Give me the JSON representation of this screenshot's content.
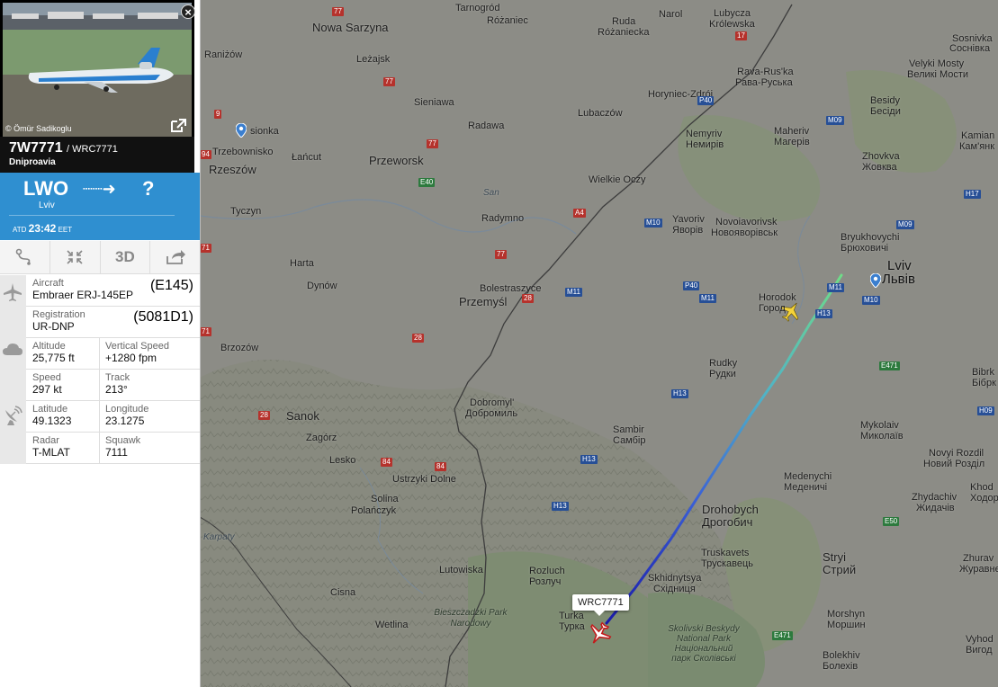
{
  "photo": {
    "credit": "© Ömür Sadikoglu"
  },
  "flight": {
    "number": "7W7771",
    "callsign": "/ WRC7771",
    "airline": "Dniproavia"
  },
  "route": {
    "from_code": "LWO",
    "from_city": "Lviv",
    "arrow": "⇢",
    "to_code": "?",
    "atd_label": "ATD",
    "atd_time": "23:42",
    "atd_tz": "EET"
  },
  "toolbar": {
    "route_icon": "route-icon",
    "fit_icon": "fit-icon",
    "three_d": "3D",
    "share_icon": "share-icon"
  },
  "details": {
    "aircraft_label": "Aircraft",
    "aircraft_value": "Embraer ERJ-145EP",
    "aircraft_code": "(E145)",
    "registration_label": "Registration",
    "registration_value": "UR-DNP",
    "registration_code": "(5081D1)",
    "altitude_label": "Altitude",
    "altitude_value": "25,775 ft",
    "vspeed_label": "Vertical Speed",
    "vspeed_value": "+1280 fpm",
    "speed_label": "Speed",
    "speed_value": "297 kt",
    "track_label": "Track",
    "track_value": "213°",
    "lat_label": "Latitude",
    "lat_value": "49.1323",
    "lon_label": "Longitude",
    "lon_value": "23.1275",
    "radar_label": "Radar",
    "radar_value": "T-MLAT",
    "squawk_label": "Squawk",
    "squawk_value": "7111"
  },
  "map": {
    "flight_tag": "WRC7771",
    "places": {
      "tarnogrod": "Tarnogród",
      "rozaniec": "Różaniec",
      "ruda": "Ruda",
      "ruda2": "Różaniecka",
      "narol": "Narol",
      "lubycza": "Lubycza",
      "lubycza2": "Królewska",
      "sosnivka": "Sosnivka",
      "sosnivka2": "Соснівка",
      "nowa": "Nowa Sarzyna",
      "lezajsk": "Leżajsk",
      "ranizow": "Raniżów",
      "ravarus": "Rava-Rus'ka",
      "ravarus2": "Рава-Руська",
      "velyki": "Velyki Mosty",
      "velyki2": "Великі Мости",
      "horyniec": "Horyniec-Zdrój",
      "sieniawa": "Sieniawa",
      "radawa": "Radawa",
      "lubaczow": "Lubaczów",
      "besidy": "Besidy",
      "besidy2": "Бесіди",
      "nemyriv": "Nemyriv",
      "nemyriv2": "Немирів",
      "maheriv": "Maheriv",
      "maheriv2": "Магерів",
      "kamianka": "Kamian",
      "kamianka2": "Кам'янк",
      "trzebownisko": "Trzebownisko",
      "lancut": "Łańcut",
      "przeworsk": "Przeworsk",
      "zhovkva": "Zhovkva",
      "zhovkva2": "Жовква",
      "rzeszow": "Rzeszów",
      "wielkie": "Wielkie Oczy",
      "tyczyn": "Tyczyn",
      "radymno": "Radymno",
      "yavoriv": "Yavoriv",
      "yavoriv2": "Яворів",
      "novoyav": "Novoiavorivsk",
      "novoyav2": "Новояворівськ",
      "bryuk": "Bryukhovychi",
      "bryuk2": "Брюховичі",
      "lviv": "Lviv",
      "lviv2": "Львів",
      "harta": "Harta",
      "bolestr": "Bolestraszyce",
      "dynow": "Dynów",
      "przemysl": "Przemyśl",
      "horodok": "Horodok",
      "horodok2": "Город",
      "brzozow": "Brzozów",
      "rudky": "Rudky",
      "rudky2": "Рудки",
      "bibrka": "Bibrk",
      "bibrka2": "Бібрк",
      "sanok": "Sanok",
      "dobromyl": "Dobromyl'",
      "dobromyl2": "Добромиль",
      "sambir": "Sambir",
      "sambir2": "Самбір",
      "mykolaiv": "Mykolaiv",
      "mykolaiv2": "Миколаїв",
      "zagorz": "Zagórz",
      "novyi": "Novyi Rozdil",
      "novyi2": "Новий Розділ",
      "lesko": "Lesko",
      "ustrzyki": "Ustrzyki Dolne",
      "medenychi": "Medenychi",
      "medenychi2": "Меденичі",
      "khod": "Khod",
      "khod2": "Ходор",
      "solina": "Solina",
      "polanczyk": "Polańczyk",
      "drohobych": "Drohobych",
      "drohobych2": "Дрогобич",
      "zhydachiv": "Zhydachiv",
      "zhydachiv2": "Жидачів",
      "karpaty": "Karpaty",
      "truskavets": "Truskavets",
      "truskavets2": "Трускавець",
      "lutowiska": "Lutowiska",
      "rozluch": "Rozluch",
      "rozluch2": "Розлуч",
      "skhidnytsya": "Skhidnytsya",
      "skhidnytsya2": "Східниця",
      "stryi": "Stryi",
      "stryi2": "Стрий",
      "zhuravne": "Zhurav",
      "zhuravne2": "Журавне",
      "cisna": "Cisna",
      "turka": "Turka",
      "turka2": "Турка",
      "morshyn": "Morshyn",
      "morshyn2": "Моршин",
      "wetlina": "Wetlina",
      "bieszczady": "Bieszczadzki Park Narodowy",
      "skolivski": "Skolivski Beskydy National Park Національний парк Сколівські",
      "bolekhiv": "Bolekhiv",
      "bolekhiv2": "Болехів",
      "vyhod": "Vyhod",
      "vyhod2": "Вигод",
      "san": "San",
      "pionka": "sionka"
    },
    "roads": {
      "r77a": "77",
      "r77b": "77",
      "r77c": "77",
      "r77d": "77",
      "r9": "9",
      "r94": "94",
      "r17": "17",
      "rP40a": "P40",
      "rM09a": "M09",
      "rM09b": "M09",
      "rH17": "H17",
      "rE40": "E40",
      "rA4": "A4",
      "rM10a": "M10",
      "rM10b": "M10",
      "rM11a": "M11",
      "rM11b": "M11",
      "rM11c": "M11",
      "rP40b": "P40",
      "r28a": "28",
      "r28b": "28",
      "r28c": "28",
      "rH13a": "H13",
      "rH13b": "H13",
      "rH13c": "H13",
      "rH13d": "H13",
      "rE471a": "E471",
      "rE471b": "E471",
      "rH09": "H09",
      "r84a": "84",
      "r84b": "84",
      "rE50": "E50",
      "r71a": "71",
      "r71b": "71"
    }
  }
}
